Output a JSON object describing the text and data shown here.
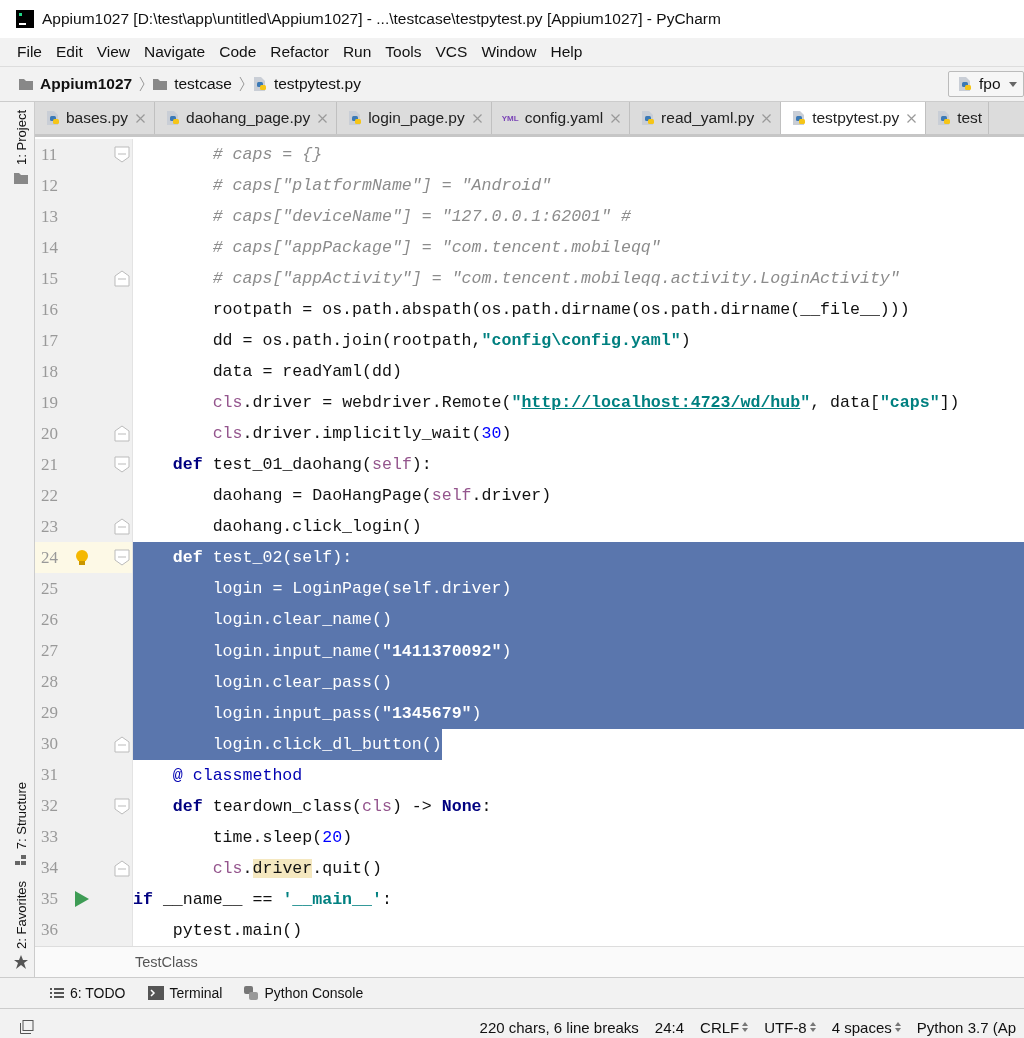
{
  "window": {
    "title": "Appium1027 [D:\\test\\app\\untitled\\Appium1027] - ...\\testcase\\testpytest.py [Appium1027] - PyCharm"
  },
  "menu": [
    "File",
    "Edit",
    "View",
    "Navigate",
    "Code",
    "Refactor",
    "Run",
    "Tools",
    "VCS",
    "Window",
    "Help"
  ],
  "breadcrumbs": [
    {
      "kind": "project",
      "label": "Appium1027"
    },
    {
      "kind": "folder",
      "label": "testcase"
    },
    {
      "kind": "python",
      "label": "testpytest.py"
    }
  ],
  "run_config": {
    "label": "fpo"
  },
  "tabs": [
    {
      "kind": "python",
      "label": "bases.py",
      "selected": false,
      "closable": true
    },
    {
      "kind": "python",
      "label": "daohang_page.py",
      "selected": false,
      "closable": true
    },
    {
      "kind": "python",
      "label": "login_page.py",
      "selected": false,
      "closable": true
    },
    {
      "kind": "yaml",
      "icon_label": "YML",
      "label": "config.yaml",
      "selected": false,
      "closable": true
    },
    {
      "kind": "python",
      "label": "read_yaml.py",
      "selected": false,
      "closable": true
    },
    {
      "kind": "python",
      "label": "testpytest.py",
      "selected": true,
      "closable": true
    },
    {
      "kind": "python",
      "label": "test",
      "selected": false,
      "closable": false
    }
  ],
  "side_tools": [
    {
      "kind": "project",
      "label": "1: Project"
    },
    {
      "kind": "structure",
      "label": "7: Structure"
    },
    {
      "kind": "favorites",
      "label": "2: Favorites"
    }
  ],
  "lines": [
    {
      "number": "11",
      "fold_start": true,
      "selected": false,
      "tokens": [
        {
          "kind": "comment",
          "text": "        # caps = {}"
        }
      ]
    },
    {
      "number": "12",
      "selected": false,
      "tokens": [
        {
          "kind": "comment",
          "text": "        # caps[\"platformName\"] = \"Android\""
        }
      ]
    },
    {
      "number": "13",
      "selected": false,
      "tokens": [
        {
          "kind": "comment",
          "text": "        # caps[\"deviceName\"] = \"127.0.0.1:62001\" #"
        }
      ]
    },
    {
      "number": "14",
      "selected": false,
      "tokens": [
        {
          "kind": "comment",
          "text": "        # caps[\"appPackage\"] = \"com.tencent.mobileqq\""
        }
      ]
    },
    {
      "number": "15",
      "fold_end": true,
      "selected": false,
      "tokens": [
        {
          "kind": "comment",
          "text": "        # caps[\"appActivity\"] = \"com.tencent.mobileqq.activity.LoginActivity\""
        }
      ]
    },
    {
      "number": "16",
      "selected": false,
      "tokens": [
        {
          "kind": "plain",
          "text": "        rootpath = os.path.abspath(os.path.dirname(os.path.dirname(__file__)))"
        }
      ]
    },
    {
      "number": "17",
      "selected": false,
      "tokens": [
        {
          "kind": "plain",
          "text": "        dd = os.path.join(rootpath,"
        },
        {
          "kind": "string",
          "text": "\"config\\config.yaml\""
        },
        {
          "kind": "plain",
          "text": ")"
        }
      ]
    },
    {
      "number": "18",
      "selected": false,
      "tokens": [
        {
          "kind": "plain",
          "text": "        data = readYaml(dd)"
        }
      ]
    },
    {
      "number": "19",
      "selected": false,
      "tokens": [
        {
          "kind": "self",
          "text": "        cls"
        },
        {
          "kind": "plain",
          "text": ".driver = webdriver.Remote("
        },
        {
          "kind": "string",
          "text": "\""
        },
        {
          "kind": "url",
          "text": "http://localhost:4723/wd/hub"
        },
        {
          "kind": "string",
          "text": "\""
        },
        {
          "kind": "plain",
          "text": ", data["
        },
        {
          "kind": "string",
          "text": "\"caps\""
        },
        {
          "kind": "plain",
          "text": "])"
        }
      ]
    },
    {
      "number": "20",
      "fold_end": true,
      "selected": false,
      "tokens": [
        {
          "kind": "self",
          "text": "        cls"
        },
        {
          "kind": "plain",
          "text": ".driver.implicitly_wait("
        },
        {
          "kind": "number",
          "text": "30"
        },
        {
          "kind": "plain",
          "text": ")"
        }
      ]
    },
    {
      "number": "21",
      "fold_start": true,
      "selected": false,
      "tokens": [
        {
          "kind": "keyword",
          "text": "    def"
        },
        {
          "kind": "plain",
          "text": " test_01_daohang("
        },
        {
          "kind": "self",
          "text": "self"
        },
        {
          "kind": "plain",
          "text": "):"
        }
      ]
    },
    {
      "number": "22",
      "selected": false,
      "tokens": [
        {
          "kind": "plain",
          "text": "        daohang = DaoHangPage("
        },
        {
          "kind": "self",
          "text": "self"
        },
        {
          "kind": "plain",
          "text": ".driver)"
        }
      ]
    },
    {
      "number": "23",
      "fold_end": true,
      "selected": false,
      "tokens": [
        {
          "kind": "plain",
          "text": "        daohang.click_login()"
        }
      ]
    },
    {
      "number": "24",
      "fold_start": true,
      "current": true,
      "bulb": true,
      "selected": true,
      "tokens": [
        {
          "kind": "keyword",
          "text": "    def"
        },
        {
          "kind": "plain",
          "text": " test_02("
        },
        {
          "kind": "self",
          "text": "self"
        },
        {
          "kind": "plain",
          "text": "):"
        }
      ]
    },
    {
      "number": "25",
      "selected": true,
      "tokens": [
        {
          "kind": "plain",
          "text": "        login = LoginPage("
        },
        {
          "kind": "self",
          "text": "self"
        },
        {
          "kind": "plain",
          "text": ".driver)"
        }
      ]
    },
    {
      "number": "26",
      "selected": true,
      "tokens": [
        {
          "kind": "plain",
          "text": "        login.clear_name()"
        }
      ]
    },
    {
      "number": "27",
      "selected": true,
      "tokens": [
        {
          "kind": "plain",
          "text": "        login.input_name("
        },
        {
          "kind": "string",
          "text": "\"1411370092\""
        },
        {
          "kind": "plain",
          "text": ")"
        }
      ]
    },
    {
      "number": "28",
      "selected": true,
      "tokens": [
        {
          "kind": "plain",
          "text": "        login.clear_pass()"
        }
      ]
    },
    {
      "number": "29",
      "selected": true,
      "tokens": [
        {
          "kind": "plain",
          "text": "        login.input_pass("
        },
        {
          "kind": "string",
          "text": "\"1345679\""
        },
        {
          "kind": "plain",
          "text": ")"
        }
      ]
    },
    {
      "number": "30",
      "fold_end": true,
      "selected": true,
      "tokens": [
        {
          "kind": "plain",
          "text": "        login.click_dl_button()"
        }
      ]
    },
    {
      "number": "31",
      "selected": false,
      "tokens": [
        {
          "kind": "decorator",
          "text": "    @ classmethod"
        }
      ]
    },
    {
      "number": "32",
      "fold_start": true,
      "selected": false,
      "tokens": [
        {
          "kind": "keyword",
          "text": "    def"
        },
        {
          "kind": "plain",
          "text": " teardown_class("
        },
        {
          "kind": "self",
          "text": "cls"
        },
        {
          "kind": "plain",
          "text": ") -> "
        },
        {
          "kind": "keyword",
          "text": "None"
        },
        {
          "kind": "plain",
          "text": ":"
        }
      ]
    },
    {
      "number": "33",
      "selected": false,
      "tokens": [
        {
          "kind": "plain",
          "text": "        time.sleep("
        },
        {
          "kind": "number",
          "text": "20"
        },
        {
          "kind": "plain",
          "text": ")"
        }
      ]
    },
    {
      "number": "34",
      "fold_end": true,
      "selected": false,
      "tokens": [
        {
          "kind": "self",
          "text": "        cls"
        },
        {
          "kind": "plain",
          "text": "."
        },
        {
          "kind": "highlight",
          "text": "driver"
        },
        {
          "kind": "plain",
          "text": ".quit()"
        }
      ]
    },
    {
      "number": "35",
      "run": true,
      "selected": false,
      "tokens": [
        {
          "kind": "keyword",
          "text": "if"
        },
        {
          "kind": "plain",
          "text": " __name__ == "
        },
        {
          "kind": "string",
          "text": "'__main__'"
        },
        {
          "kind": "plain",
          "text": ":"
        }
      ]
    },
    {
      "number": "36",
      "selected": false,
      "tokens": [
        {
          "kind": "plain",
          "text": "    pytest.main()"
        }
      ]
    }
  ],
  "editor_breadcrumb": "TestClass",
  "tool_buttons": [
    {
      "kind": "todo",
      "label": "6: TODO"
    },
    {
      "kind": "terminal",
      "label": "Terminal"
    },
    {
      "kind": "console",
      "label": "Python Console"
    }
  ],
  "status_bar": [
    {
      "kind": "text",
      "label": "220 chars, 6 line breaks"
    },
    {
      "kind": "text",
      "label": "24:4"
    },
    {
      "kind": "dropdown",
      "label": "CRLF"
    },
    {
      "kind": "dropdown",
      "label": "UTF-8"
    },
    {
      "kind": "dropdown",
      "label": "4 spaces"
    },
    {
      "kind": "text",
      "label": "Python 3.7 (Ap"
    }
  ]
}
